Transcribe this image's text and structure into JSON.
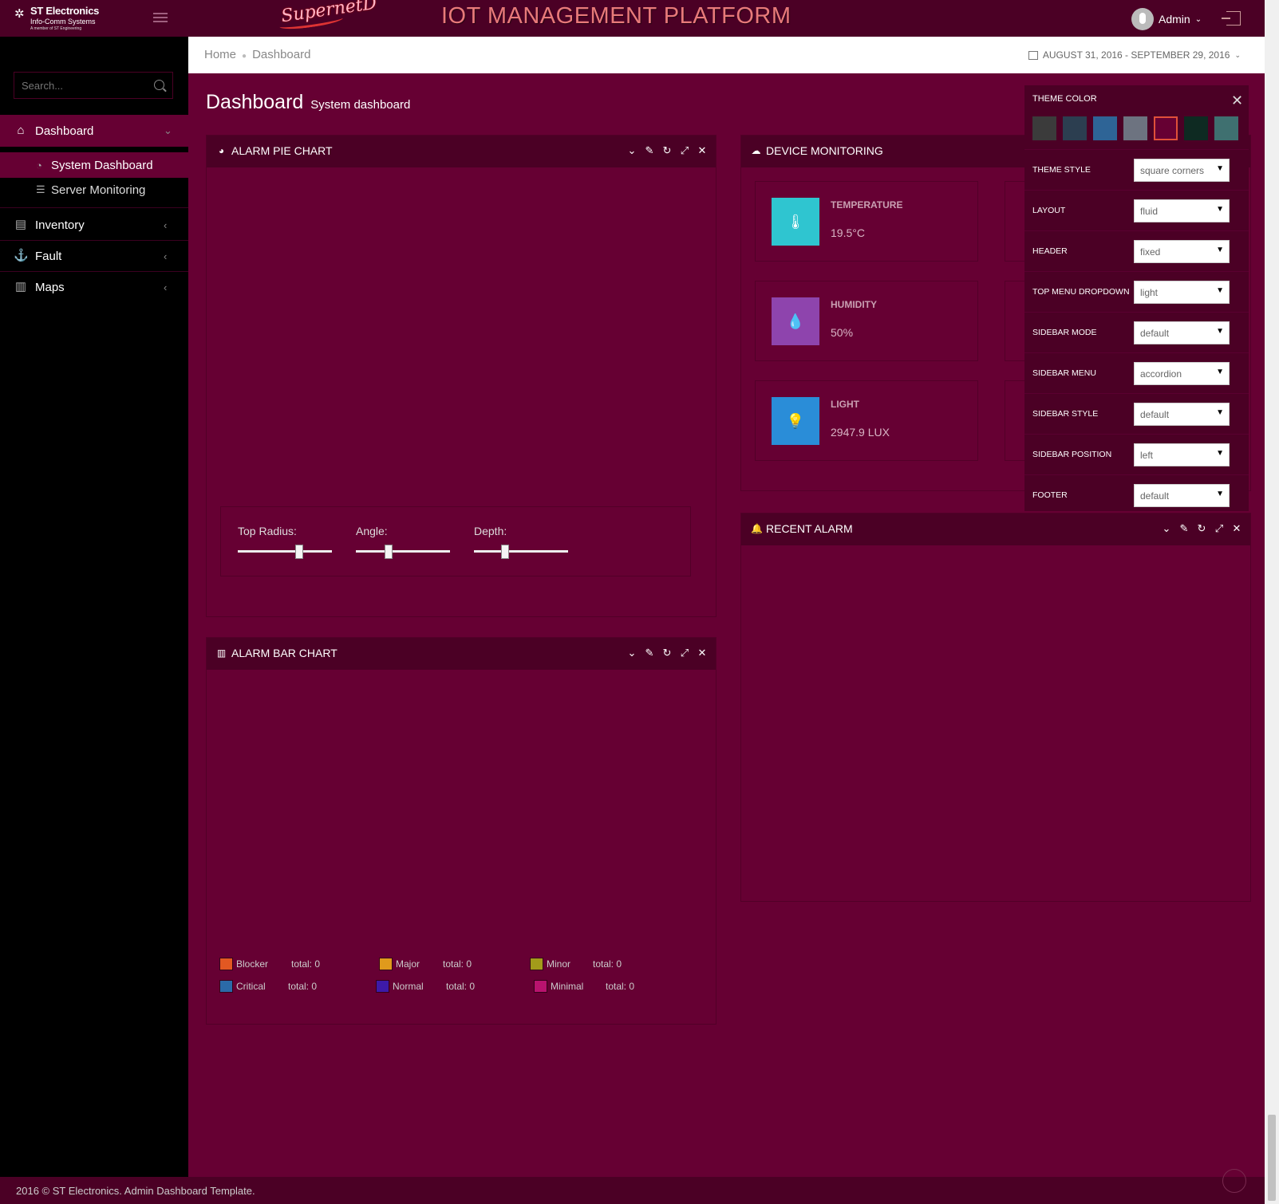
{
  "header": {
    "brand_name": "ST Electronics",
    "brand_sub": "Info-Comm Systems",
    "brand_tag": "A member of ST Engineering",
    "logo_text": "SupernetD",
    "title": "IOT MANAGEMENT PLATFORM",
    "user_name": "Admin"
  },
  "sidebar": {
    "search_placeholder": "Search...",
    "items": [
      {
        "label": "Dashboard",
        "icon": "home-icon"
      },
      {
        "label": "System Dashboard",
        "icon": "dashboard-icon"
      },
      {
        "label": "Server Monitoring",
        "icon": "server-icon"
      },
      {
        "label": "Inventory",
        "icon": "list-icon"
      },
      {
        "label": "Fault",
        "icon": "anchor-icon"
      },
      {
        "label": "Maps",
        "icon": "map-icon"
      }
    ]
  },
  "breadcrumb": {
    "home": "Home",
    "current": "Dashboard"
  },
  "date_range": "AUGUST 31, 2016 - SEPTEMBER 29, 2016",
  "page": {
    "title": "Dashboard",
    "subtitle": "System dashboard"
  },
  "pie_panel": {
    "title": "ALARM PIE CHART",
    "sliders": [
      {
        "label": "Top Radius:",
        "value": 0.65
      },
      {
        "label": "Angle:",
        "value": 0.35
      },
      {
        "label": "Depth:",
        "value": 0.33
      }
    ]
  },
  "bar_panel": {
    "title": "ALARM BAR CHART",
    "legend": [
      {
        "name": "Blocker",
        "total": "total: 0",
        "color": "#e25822"
      },
      {
        "name": "Major",
        "total": "total: 0",
        "color": "#e09a1c"
      },
      {
        "name": "Minor",
        "total": "total: 0",
        "color": "#a39b1a"
      },
      {
        "name": "Critical",
        "total": "total: 0",
        "color": "#2b6aa8"
      },
      {
        "name": "Normal",
        "total": "total: 0",
        "color": "#3d1aa8"
      },
      {
        "name": "Minimal",
        "total": "total: 0",
        "color": "#b8136e"
      }
    ]
  },
  "device_panel": {
    "title": "DEVICE MONITORING",
    "cards": [
      {
        "name": "TEMPERATURE",
        "value": "19.5°C",
        "color": "#2fc5d0",
        "icon": "thermometer-icon"
      },
      {
        "name": "HUMIDITY",
        "value": "50%",
        "color": "#8e44ad",
        "icon": "water-drop-icon"
      },
      {
        "name": "LIGHT",
        "value": "2947.9 LUX",
        "color": "#2a8dd8",
        "icon": "light-bulb-icon"
      }
    ]
  },
  "alarm_panel": {
    "title": "RECENT ALARM"
  },
  "theme_panel": {
    "title": "THEME COLOR",
    "swatches": [
      "#3b3b3b",
      "#2c3e50",
      "#2e6496",
      "#6d7380",
      "#660033",
      "#0e2a22",
      "#3f7070"
    ],
    "selected_swatch": 4,
    "rows": [
      {
        "label": "THEME STYLE",
        "value": "square corners"
      },
      {
        "label": "LAYOUT",
        "value": "fluid"
      },
      {
        "label": "HEADER",
        "value": "fixed"
      },
      {
        "label": "TOP MENU DROPDOWN",
        "value": "light"
      },
      {
        "label": "SIDEBAR MODE",
        "value": "default"
      },
      {
        "label": "SIDEBAR MENU",
        "value": "accordion"
      },
      {
        "label": "SIDEBAR STYLE",
        "value": "default"
      },
      {
        "label": "SIDEBAR POSITION",
        "value": "left"
      },
      {
        "label": "FOOTER",
        "value": "default"
      }
    ]
  },
  "footer": {
    "text": "2016 © ST Electronics. Admin Dashboard Template."
  }
}
